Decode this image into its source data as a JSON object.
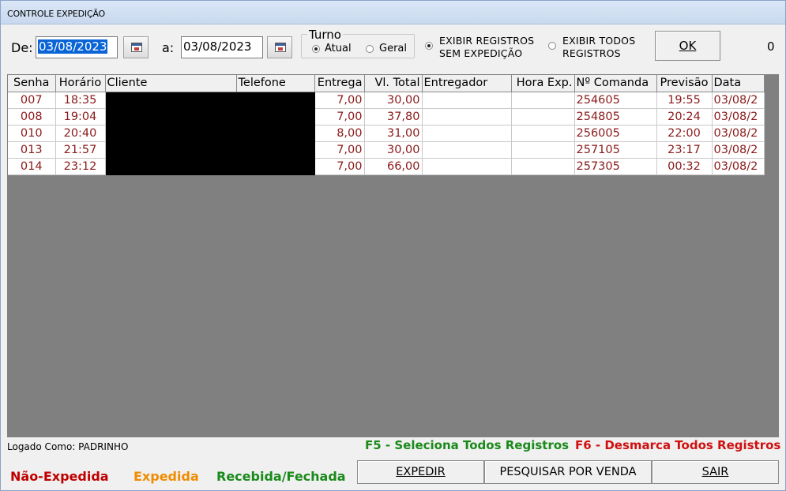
{
  "window": {
    "title": "CONTROLE EXPEDIÇÃO"
  },
  "filters": {
    "from_label": "De:",
    "from_value": "03/08/2023",
    "to_label": "a:",
    "to_value": "03/08/2023",
    "turno": {
      "label": "Turno",
      "options": [
        {
          "label": "Atual",
          "selected": true
        },
        {
          "label": "Geral",
          "selected": false
        }
      ]
    },
    "display_options": [
      {
        "label_line1": "EXIBIR REGISTROS",
        "label_line2": "SEM EXPEDIÇÃO",
        "selected": true
      },
      {
        "label_line1": "EXIBIR TODOS",
        "label_line2": "REGISTROS",
        "selected": false
      }
    ],
    "ok_label": "OK",
    "record_count": "0"
  },
  "table": {
    "columns": [
      "Senha",
      "Horário",
      "Cliente",
      "Telefone",
      "Entrega",
      "Vl. Total",
      "Entregador",
      "Hora Exp.",
      "Nº Comanda",
      "Previsão",
      "Data"
    ],
    "rows": [
      [
        "007",
        "18:35",
        "",
        "",
        "7,00",
        "30,00",
        "",
        "",
        "254605",
        "19:55",
        "03/08/2"
      ],
      [
        "008",
        "19:04",
        "",
        "",
        "7,00",
        "37,80",
        "",
        "",
        "254805",
        "20:24",
        "03/08/2"
      ],
      [
        "010",
        "20:40",
        "",
        "",
        "8,00",
        "31,00",
        "",
        "",
        "256005",
        "22:00",
        "03/08/2"
      ],
      [
        "013",
        "21:57",
        "",
        "",
        "7,00",
        "30,00",
        "",
        "",
        "257105",
        "23:17",
        "03/08/2"
      ],
      [
        "014",
        "23:12",
        "",
        "",
        "7,00",
        "66,00",
        "",
        "",
        "257305",
        "00:32",
        "03/08/2"
      ]
    ]
  },
  "status": {
    "logged_as": "Logado Como: PADRINHO",
    "hint_f5": "F5 - Seleciona Todos Registros",
    "hint_f6": "F6 - Desmarca Todos Registros"
  },
  "legend": [
    {
      "label": "Não-Expedida",
      "color": "#c00000"
    },
    {
      "label": "Expedida",
      "color": "#f08c00"
    },
    {
      "label": "Recebida/Fechada",
      "color": "#1a8a1a"
    }
  ],
  "buttons": {
    "expedir": "EXPEDIR",
    "pesquisar": "PESQUISAR POR VENDA",
    "sair": "SAIR"
  },
  "colors": {
    "row_text": "#8b1a1a",
    "selection": "#0a64d6",
    "grid_background": "#808080",
    "hint_f5": "#1a8a1a",
    "hint_f6": "#d01010"
  }
}
